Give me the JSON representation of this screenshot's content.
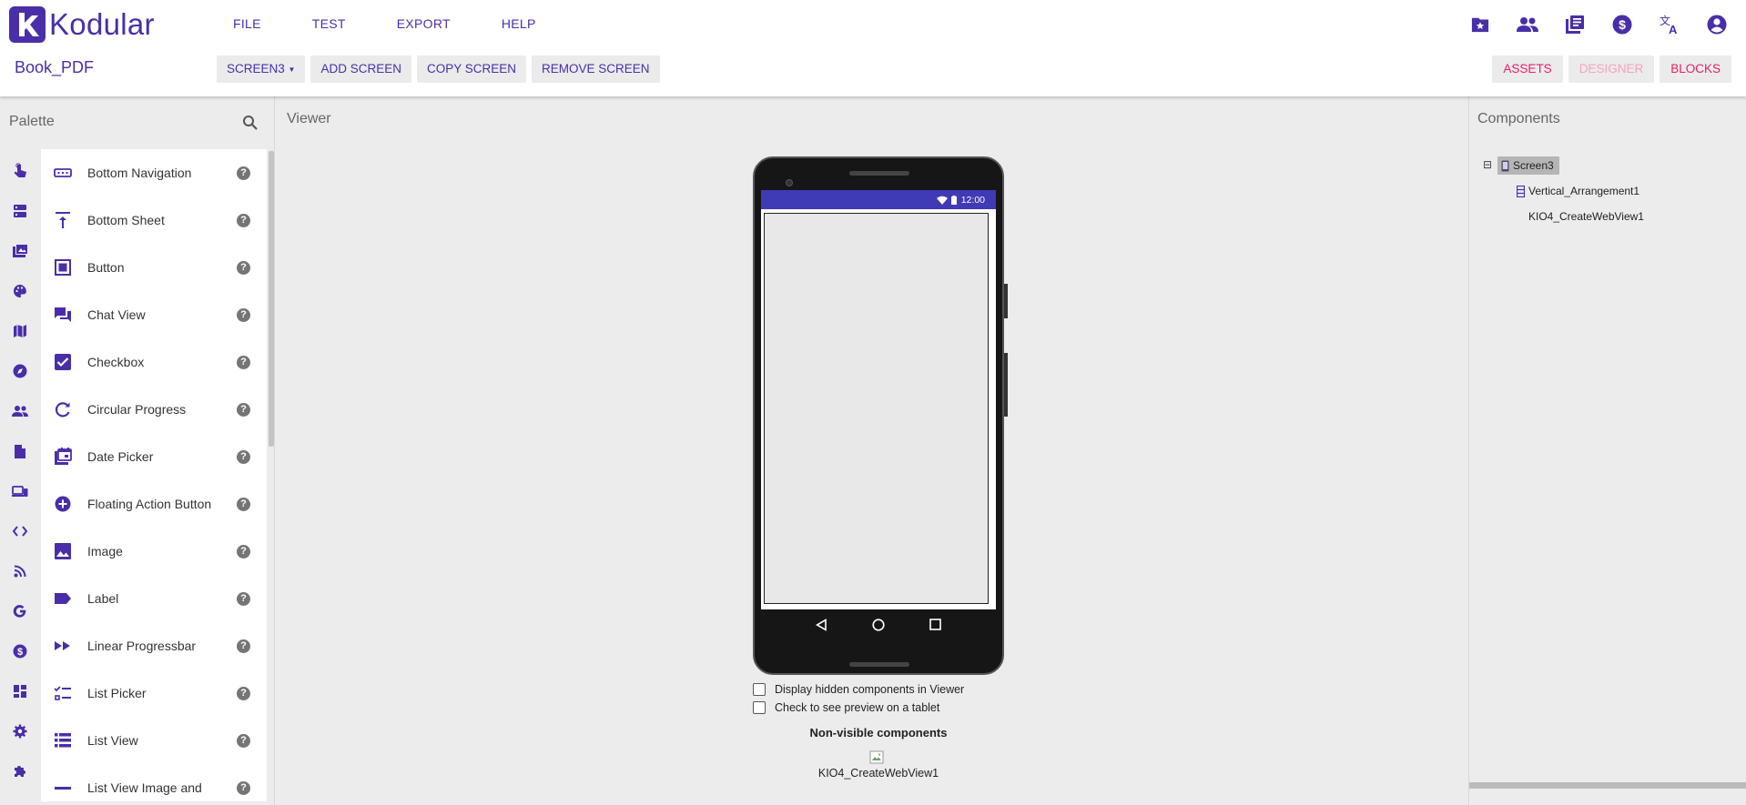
{
  "app": {
    "brand": "Kodular",
    "logo_letter": "k",
    "accent_color": "#4a2ea8",
    "pink_color": "#e91e63"
  },
  "menu": {
    "items": [
      "FILE",
      "TEST",
      "EXPORT",
      "HELP"
    ]
  },
  "top_icons": [
    "folder-star-icon",
    "people-icon",
    "library-icon",
    "dollar-icon",
    "translate-icon",
    "account-icon"
  ],
  "project": {
    "name": "Book_PDF"
  },
  "screen_toolbar": {
    "current_screen": "SCREEN3",
    "add_label": "ADD SCREEN",
    "copy_label": "COPY SCREEN",
    "remove_label": "REMOVE SCREEN"
  },
  "view_toolbar": {
    "assets_label": "ASSETS",
    "designer_label": "DESIGNER",
    "blocks_label": "BLOCKS",
    "active": "DESIGNER"
  },
  "palette": {
    "title": "Palette",
    "categories": [
      "touch-icon",
      "layout-icon",
      "media-icon",
      "drawing-icon",
      "maps-icon",
      "sensors-icon",
      "social-icon",
      "storage-icon",
      "connectivity-icon",
      "code-icon",
      "feed-icon",
      "google-icon",
      "monetization-icon",
      "dashboard-icon",
      "settings-icon",
      "extension-icon"
    ],
    "items": [
      {
        "label": "Bottom Navigation",
        "icon": "bottom-navigation-icon"
      },
      {
        "label": "Bottom Sheet",
        "icon": "bottom-sheet-icon"
      },
      {
        "label": "Button",
        "icon": "button-icon"
      },
      {
        "label": "Chat View",
        "icon": "chat-view-icon"
      },
      {
        "label": "Checkbox",
        "icon": "checkbox-icon"
      },
      {
        "label": "Circular Progress",
        "icon": "circular-progress-icon"
      },
      {
        "label": "Date Picker",
        "icon": "date-picker-icon"
      },
      {
        "label": "Floating Action Button",
        "icon": "floating-action-button-icon"
      },
      {
        "label": "Image",
        "icon": "image-icon"
      },
      {
        "label": "Label",
        "icon": "label-icon"
      },
      {
        "label": "Linear Progressbar",
        "icon": "linear-progressbar-icon"
      },
      {
        "label": "List Picker",
        "icon": "list-picker-icon"
      },
      {
        "label": "List View",
        "icon": "list-view-icon"
      },
      {
        "label": "List View Image and",
        "icon": "list-view-image-icon"
      }
    ],
    "help_glyph": "?"
  },
  "viewer": {
    "title": "Viewer",
    "status_time": "12:00",
    "checkbox_hidden": "Display hidden components in Viewer",
    "checkbox_tablet": "Check to see preview on a tablet",
    "nonvisible_title": "Non-visible components",
    "nonvisible_items": [
      "KIO4_CreateWebView1"
    ]
  },
  "components": {
    "title": "Components",
    "toggle_glyph": "⊟",
    "root": "Screen3",
    "children": [
      {
        "label": "Vertical_Arrangement1",
        "icon": "vertical-arrangement-icon"
      },
      {
        "label": "KIO4_CreateWebView1",
        "icon": ""
      }
    ]
  }
}
